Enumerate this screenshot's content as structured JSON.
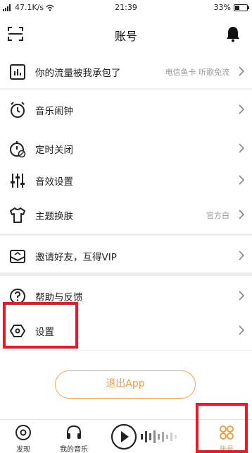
{
  "status_bar": {
    "network": "47.1K/s",
    "time": "21:39",
    "battery": "33%",
    "battery_level": 0.33
  },
  "header": {
    "title": "账号",
    "left_icon": "scan-icon",
    "right_icon": "bell-icon"
  },
  "menu": {
    "traffic": {
      "label": "你的流量被我承包了",
      "sub": "电信鱼卡 听歌免流"
    },
    "alarm": {
      "label": "音乐闹钟"
    },
    "timer": {
      "label": "定时关闭"
    },
    "sound": {
      "label": "音效设置"
    },
    "theme": {
      "label": "主题换肤",
      "sub": "官方白"
    },
    "invite": {
      "label": "邀请好友，互得VIP"
    },
    "help": {
      "label": "帮助与反馈"
    },
    "settings": {
      "label": "设置"
    }
  },
  "logout_label": "退出App",
  "tabbar": {
    "discover": "发现",
    "my_music": "我的音乐",
    "account": "账号"
  },
  "colors": {
    "accent": "#f29a44",
    "highlight": "#e81b24",
    "gap": "#eeeeee"
  }
}
